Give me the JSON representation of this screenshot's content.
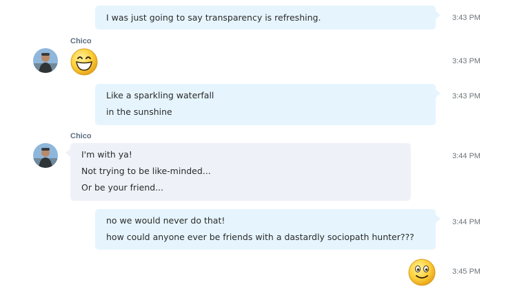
{
  "conversation": {
    "messages": [
      {
        "lines": [
          "I was just going to say transparency is refreshing."
        ],
        "time": "3:43 PM"
      },
      {
        "sender": "Chico",
        "emoticon": "laugh",
        "time": "3:43 PM"
      },
      {
        "lines": [
          "Like a sparkling waterfall",
          "in the sunshine"
        ],
        "time": "3:43 PM"
      },
      {
        "sender": "Chico",
        "lines": [
          "I'm with ya!",
          "Not trying to be like-minded...",
          "Or be your friend..."
        ],
        "time": "3:44 PM"
      },
      {
        "lines": [
          "no we would never do that!",
          "how could anyone ever be friends with a dastardly sociopath hunter???"
        ],
        "time": "3:44 PM"
      },
      {
        "emoticon": "smile",
        "time": "3:45 PM"
      }
    ]
  },
  "colors": {
    "outgoing_bubble": "#e6f5fd",
    "incoming_bubble": "#eef2f8",
    "sender_name": "#5c6e80",
    "timestamp": "#6c7378",
    "emoticon_face": "#ffd23a"
  }
}
